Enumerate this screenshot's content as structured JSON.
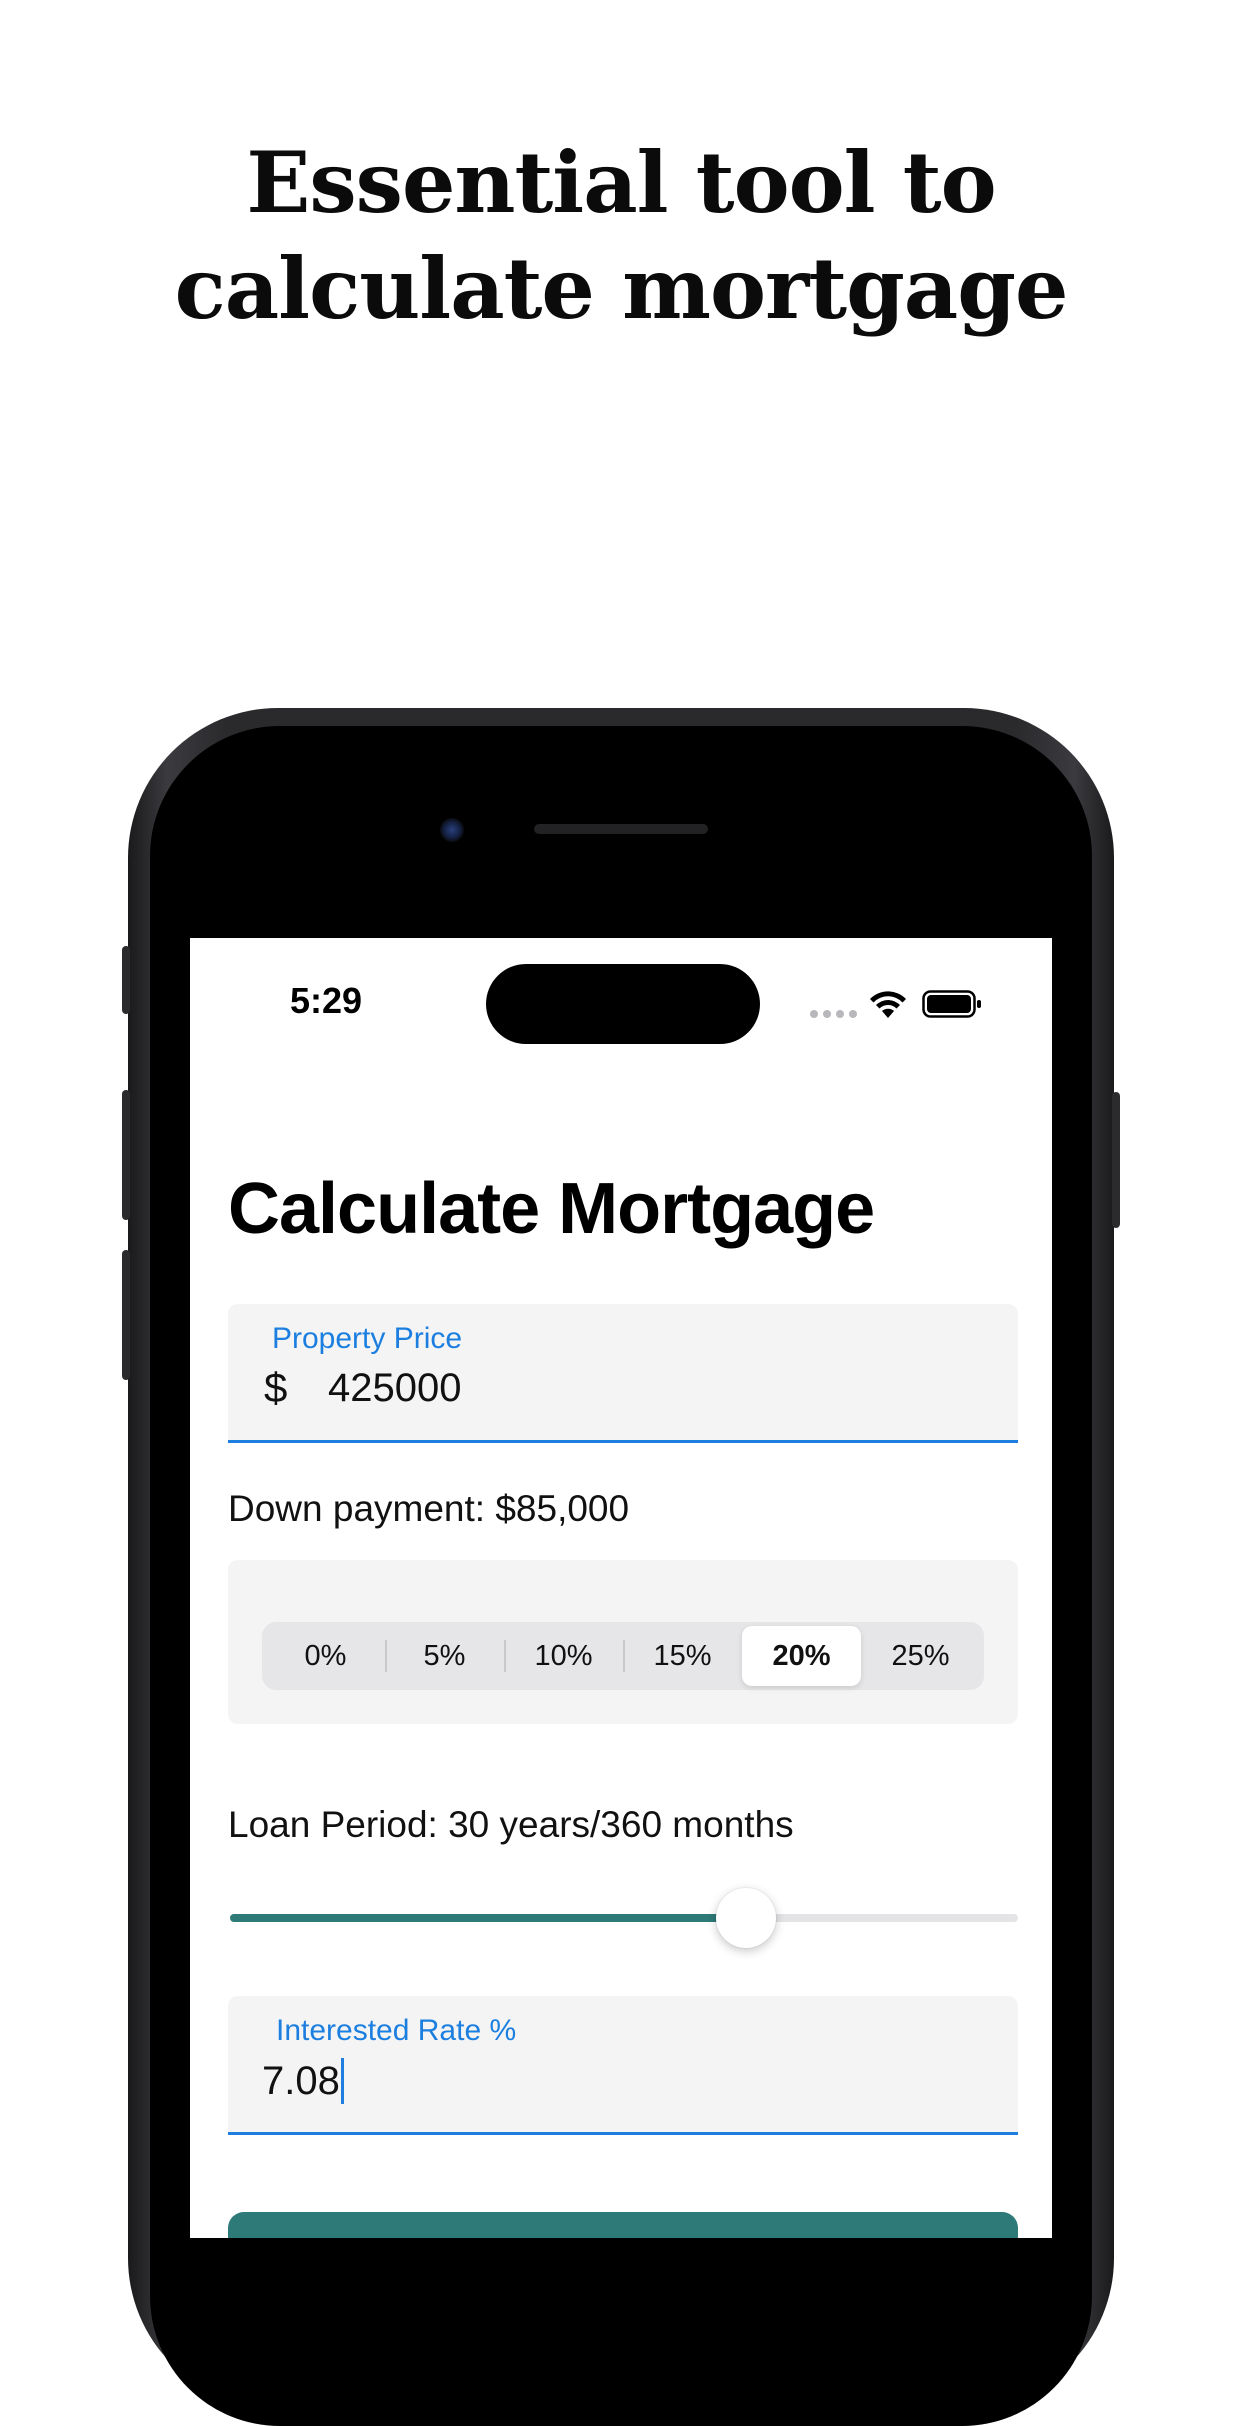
{
  "headline": {
    "line1": "Essential tool to",
    "line2": "calculate mortgage"
  },
  "status_bar": {
    "time": "5:29",
    "icons": [
      "signal-dots-icon",
      "wifi-icon",
      "battery-icon"
    ]
  },
  "page": {
    "title": "Calculate Mortgage"
  },
  "property_price": {
    "label": "Property Price",
    "prefix": "$",
    "value": "425000"
  },
  "down_payment": {
    "label": "Down payment: $85,000",
    "options": [
      "0%",
      "5%",
      "10%",
      "15%",
      "20%",
      "25%"
    ],
    "selected": "20%"
  },
  "loan_period": {
    "label": "Loan Period: 30 years/360 months",
    "slider_fraction": 0.655
  },
  "interest_rate": {
    "label": "Interested Rate %",
    "value": "7.08"
  },
  "colors": {
    "accent_blue": "#1c7fe0",
    "teal": "#2e7a78",
    "field_bg": "#f4f4f4"
  }
}
